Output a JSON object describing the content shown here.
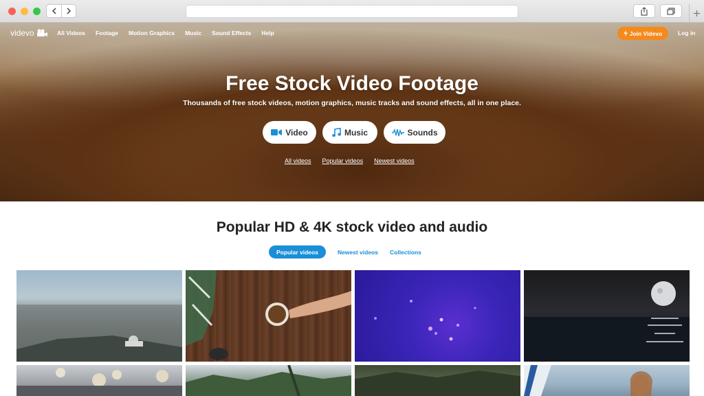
{
  "nav": {
    "logo_text": "videvo",
    "links": [
      "All Videos",
      "Footage",
      "Motion Graphics",
      "Music",
      "Sound Effects",
      "Help"
    ],
    "join_label": "Join Videvo",
    "login_label": "Log in"
  },
  "hero": {
    "title": "Free Stock Video Footage",
    "subtitle": "Thousands of free stock videos, motion graphics, music tracks and sound effects, all in one place.",
    "categories": [
      {
        "label": "Video",
        "icon": "video-camera-icon"
      },
      {
        "label": "Music",
        "icon": "music-note-icon"
      },
      {
        "label": "Sounds",
        "icon": "sound-wave-icon"
      }
    ],
    "links": [
      "All videos",
      "Popular videos",
      "Newest videos"
    ]
  },
  "section": {
    "title": "Popular HD & 4K stock video and audio",
    "tabs": [
      "Popular videos",
      "Newest videos",
      "Collections"
    ],
    "active_tab": "Popular videos"
  },
  "colors": {
    "accent_blue": "#1a8fd8",
    "join_orange": "#f48a1c",
    "category_icon_blue": "#1a8fd8"
  }
}
